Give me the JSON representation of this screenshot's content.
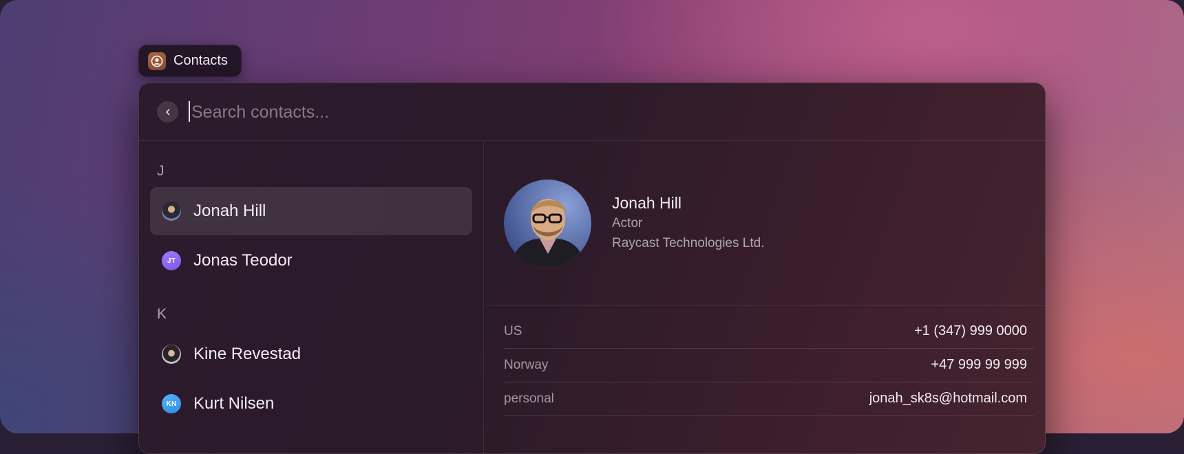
{
  "app": {
    "name": "Contacts",
    "icon": "contacts-app-icon"
  },
  "search": {
    "placeholder": "Search contacts...",
    "value": ""
  },
  "sections": [
    {
      "letter": "J",
      "contacts": [
        {
          "name": "Jonah Hill",
          "avatar": "photo",
          "selected": true
        },
        {
          "name": "Jonas Teodor",
          "avatar": "initials",
          "initials": "JT",
          "color": "#8b66f5"
        }
      ]
    },
    {
      "letter": "K",
      "contacts": [
        {
          "name": "Kine Revestad",
          "avatar": "photo"
        },
        {
          "name": "Kurt Nilsen",
          "avatar": "initials",
          "initials": "KN",
          "color": "#3ea0f0"
        }
      ]
    }
  ],
  "detail": {
    "name": "Jonah Hill",
    "title": "Actor",
    "company": "Raycast Technologies Ltd.",
    "fields": [
      {
        "label": "US",
        "value": "+1 (347) 999 0000"
      },
      {
        "label": "Norway",
        "value": "+47 999 99 999"
      },
      {
        "label": "personal",
        "value": "jonah_sk8s@hotmail.com"
      }
    ]
  },
  "colors": {
    "accent_purple": "#8b66f5",
    "accent_blue": "#3ea0f0",
    "app_icon": "#a35c3c"
  }
}
